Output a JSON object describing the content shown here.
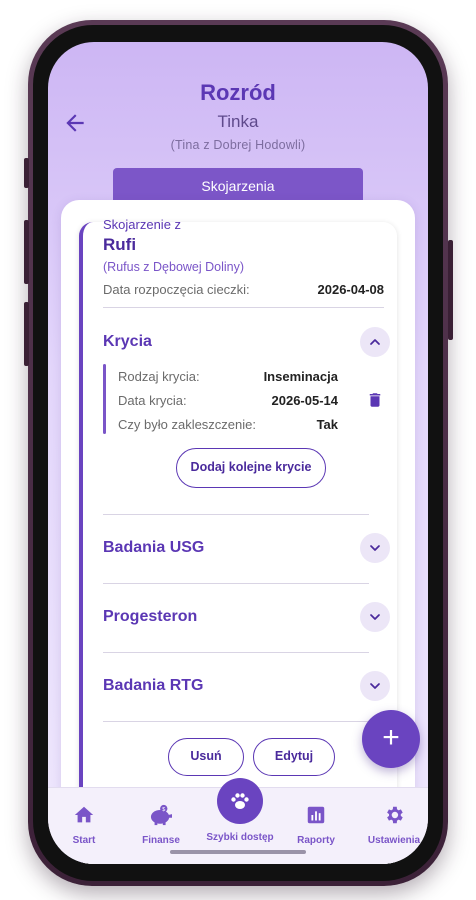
{
  "header": {
    "title": "Rozród",
    "subtitle": "Tinka",
    "full_name": "(Tina z Dobrej Hodowli)"
  },
  "tab": {
    "label": "Skojarzenia"
  },
  "pairing": {
    "heading": "Skojarzenie z",
    "partner_name": "Rufi",
    "partner_full_name": "(Rufus z Dębowej Doliny)",
    "heat_start_label": "Data rozpoczęcia cieczki:",
    "heat_start_value": "2026-04-08"
  },
  "sections": {
    "matings": {
      "title": "Krycia",
      "expanded": true,
      "entry": {
        "type_label": "Rodzaj krycia:",
        "type_value": "Inseminacja",
        "date_label": "Data krycia:",
        "date_value": "2026-05-14",
        "tie_label": "Czy było zakleszczenie:",
        "tie_value": "Tak"
      },
      "add_button": "Dodaj kolejne krycie"
    },
    "usg": {
      "title": "Badania USG"
    },
    "progesterone": {
      "title": "Progesteron"
    },
    "rtg": {
      "title": "Badania RTG"
    }
  },
  "actions": {
    "delete": "Usuń",
    "edit": "Edytuj"
  },
  "fab": {
    "label": "+"
  },
  "nav": {
    "items": [
      {
        "label": "Start",
        "icon": "home-icon"
      },
      {
        "label": "Finanse",
        "icon": "piggy-bank-icon"
      },
      {
        "label": "Szybki dostęp",
        "icon": "paw-icon"
      },
      {
        "label": "Raporty",
        "icon": "chart-icon"
      },
      {
        "label": "Ustawienia",
        "icon": "gear-icon"
      }
    ]
  },
  "colors": {
    "accent": "#6a44c0",
    "title": "#5b37b4",
    "background": "#e3d6fb"
  }
}
